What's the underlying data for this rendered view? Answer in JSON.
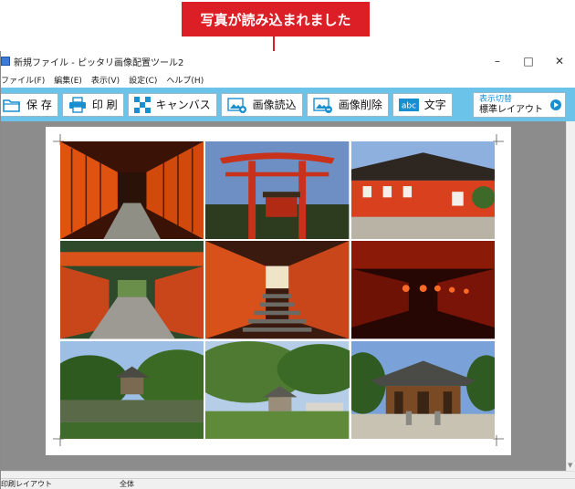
{
  "callout": {
    "text": "写真が読み込まれました"
  },
  "window": {
    "title": "新規ファイル - ピッタリ画像配置ツール2",
    "controls": {
      "minimize": "–",
      "maximize": "□",
      "close": "✕"
    }
  },
  "menu": {
    "items": [
      {
        "label": "ファイル(F)"
      },
      {
        "label": "編集(E)"
      },
      {
        "label": "表示(V)"
      },
      {
        "label": "設定(C)"
      },
      {
        "label": "ヘルプ(H)"
      }
    ]
  },
  "toolbar": {
    "save": "保 存",
    "print": "印 刷",
    "canvas": "キャンバス",
    "image_load": "画像読込",
    "image_delete": "画像削除",
    "text": "文字",
    "text_icon_label": "abc",
    "display_switch_top": "表示切替",
    "display_switch_bottom": "標準レイアウト"
  },
  "status": {
    "left": "印刷レイアウト",
    "right": "全体"
  },
  "colors": {
    "accent": "#dc1f26",
    "toolbar": "#6bc3ea",
    "workspace": "#8c8c8c",
    "link_blue": "#1a8fd0"
  },
  "photos": [
    {
      "scene": "torii-tunnel"
    },
    {
      "scene": "torii-gate-sky"
    },
    {
      "scene": "shrine-buildings"
    },
    {
      "scene": "torii-path-stone"
    },
    {
      "scene": "torii-stairs"
    },
    {
      "scene": "torii-lanterns-night"
    },
    {
      "scene": "garden-pond-pavilion"
    },
    {
      "scene": "garden-green-temple"
    },
    {
      "scene": "temple-hall-courtyard"
    }
  ]
}
